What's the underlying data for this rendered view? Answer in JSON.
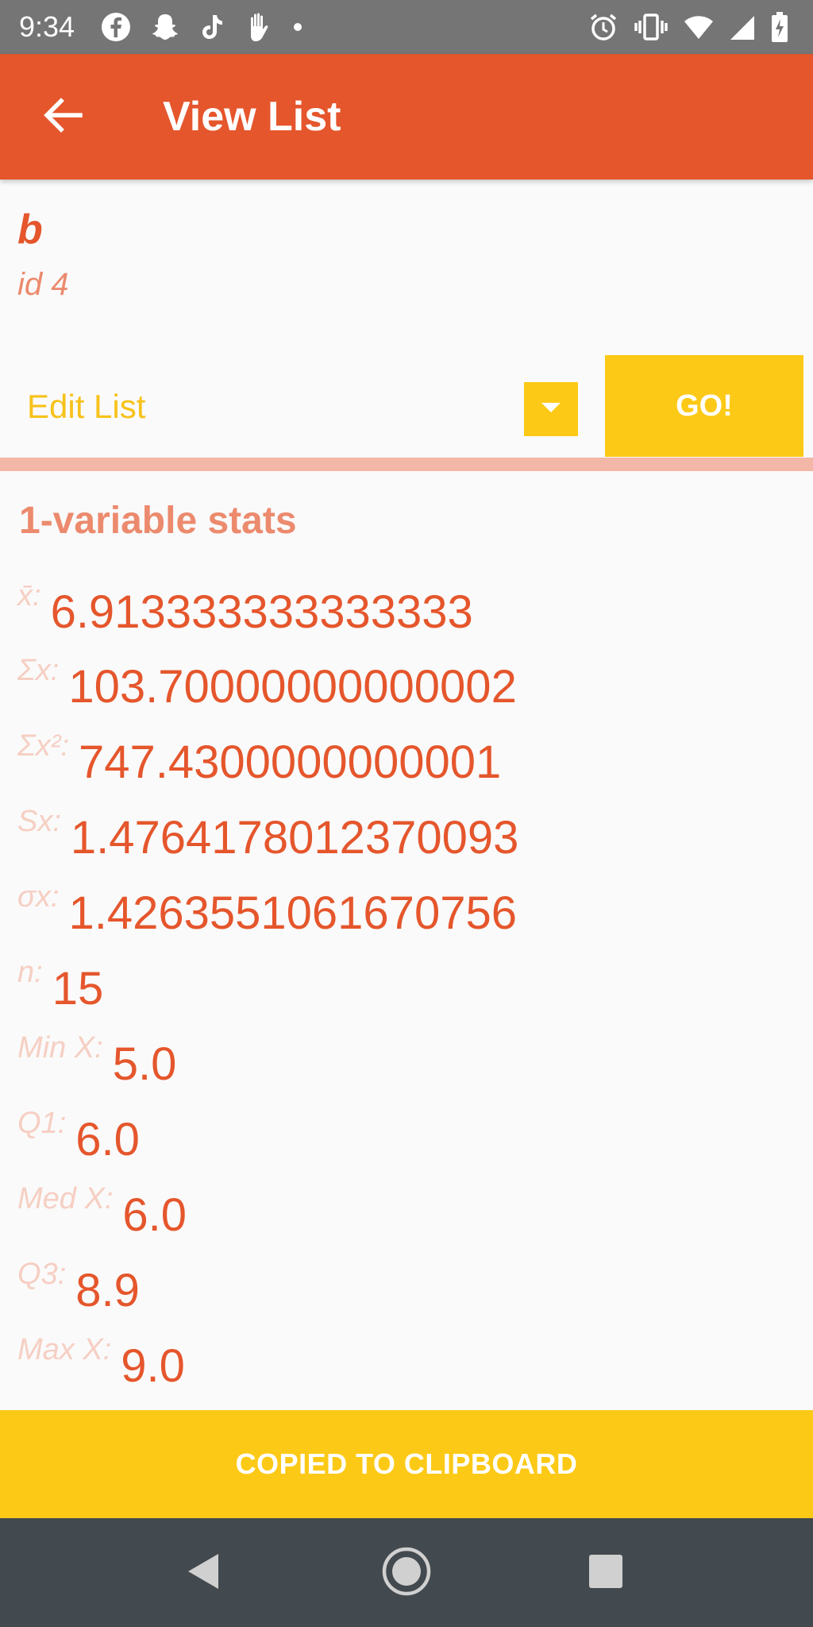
{
  "status_bar": {
    "time": "9:34",
    "left_icons": [
      "facebook-icon",
      "snapchat-icon",
      "tiktok-icon",
      "hand-icon",
      "dot-icon"
    ],
    "right_icons": [
      "alarm-icon",
      "vibrate-icon",
      "wifi-icon",
      "signal-icon",
      "battery-charging-icon"
    ]
  },
  "app_bar": {
    "title": "View List",
    "back_icon": "arrow-left-icon",
    "color": "#e5562c"
  },
  "list": {
    "name": "b",
    "id_text": "id 4"
  },
  "action": {
    "selected": "Edit List",
    "go_label": "GO!",
    "accent": "#fcc916"
  },
  "stats": {
    "title": "1-variable stats",
    "rows": [
      {
        "label": "x̄:",
        "value": "6.913333333333333"
      },
      {
        "label": "Σx:",
        "value": "103.70000000000002"
      },
      {
        "label": "Σx²:",
        "value": "747.4300000000001"
      },
      {
        "label": "Sx:",
        "value": "1.4764178012370093"
      },
      {
        "label": "σx:",
        "value": "1.4263551061670756"
      },
      {
        "label": "n:",
        "value": "15"
      },
      {
        "label": "Min X:",
        "value": "5.0"
      },
      {
        "label": "Q1:",
        "value": "6.0"
      },
      {
        "label": "Med X:",
        "value": "6.0"
      },
      {
        "label": "Q3:",
        "value": "8.9"
      },
      {
        "label": "Max X:",
        "value": "9.0"
      }
    ]
  },
  "snackbar": {
    "text": "COPIED TO CLIPBOARD"
  },
  "nav_bar": {
    "buttons": [
      "back-triangle-icon",
      "home-circle-icon",
      "recents-square-icon"
    ]
  }
}
